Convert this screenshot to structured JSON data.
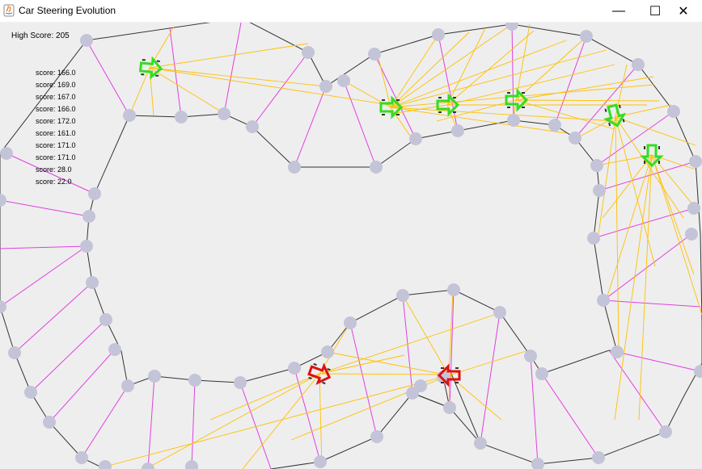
{
  "window": {
    "title": "Car Steering Evolution",
    "minimize_glyph": "—",
    "maximize_glyph": "☐",
    "close_glyph": "✕"
  },
  "hud": {
    "high_score": "High Score: 205",
    "scores": [
      "score: 166.0",
      "score: 169.0",
      "score: 167.0",
      "score: 166.0",
      "score: 172.0",
      "score: 161.0",
      "score: 171.0",
      "score: 171.0",
      "score: 28.0",
      "score: 22.0"
    ]
  },
  "colors": {
    "background": "#eeeeee",
    "track_line": "#333333",
    "waypoint": "#c4c4d8",
    "gate_line": "#e040e0",
    "sensor_ray": "#ffc000",
    "car_alive": "#33dd22",
    "car_dead": "#dd1111"
  },
  "icons": {
    "app": "java-icon"
  }
}
